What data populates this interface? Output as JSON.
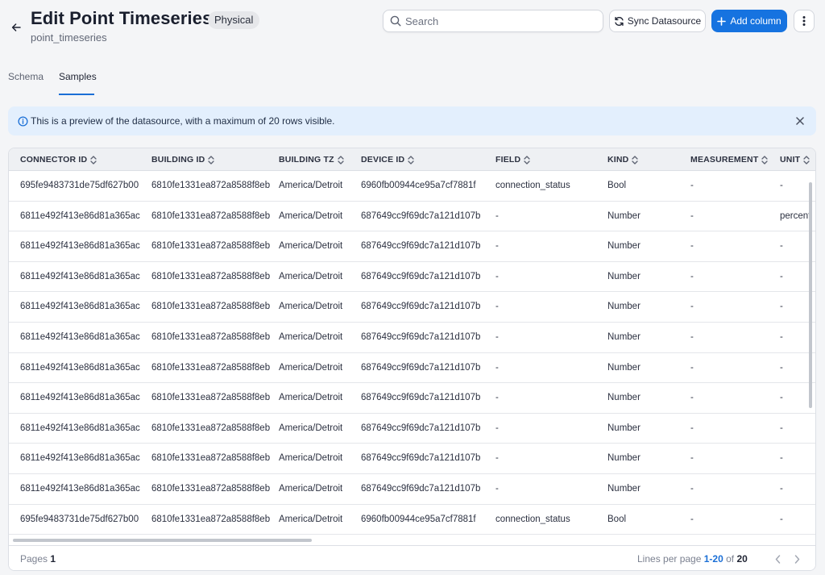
{
  "header": {
    "title": "Edit Point Timeseries",
    "badge": "Physical",
    "subtitle": "point_timeseries",
    "search_placeholder": "Search",
    "sync_label": "Sync Datasource",
    "add_label": "Add column"
  },
  "tabs": [
    {
      "label": "Schema",
      "active": false
    },
    {
      "label": "Samples",
      "active": true
    }
  ],
  "info": {
    "message": "This is a preview of the datasource, with a maximum of 20 rows visible."
  },
  "table": {
    "columns": [
      "CONNECTOR ID",
      "BUILDING ID",
      "BUILDING TZ",
      "DEVICE ID",
      "FIELD",
      "KIND",
      "MEASUREMENT",
      "UNIT"
    ],
    "rows": [
      [
        "695fe9483731de75df627b00",
        "6810fe1331ea872a8588f8eb",
        "America/Detroit",
        "6960fb00944ce95a7cf7881f",
        "connection_status",
        "Bool",
        "-",
        "-"
      ],
      [
        "6811e492f413e86d81a365ac",
        "6810fe1331ea872a8588f8eb",
        "America/Detroit",
        "687649cc9f69dc7a121d107b",
        "-",
        "Number",
        "-",
        "percent"
      ],
      [
        "6811e492f413e86d81a365ac",
        "6810fe1331ea872a8588f8eb",
        "America/Detroit",
        "687649cc9f69dc7a121d107b",
        "-",
        "Number",
        "-",
        "-"
      ],
      [
        "6811e492f413e86d81a365ac",
        "6810fe1331ea872a8588f8eb",
        "America/Detroit",
        "687649cc9f69dc7a121d107b",
        "-",
        "Number",
        "-",
        "-"
      ],
      [
        "6811e492f413e86d81a365ac",
        "6810fe1331ea872a8588f8eb",
        "America/Detroit",
        "687649cc9f69dc7a121d107b",
        "-",
        "Number",
        "-",
        "-"
      ],
      [
        "6811e492f413e86d81a365ac",
        "6810fe1331ea872a8588f8eb",
        "America/Detroit",
        "687649cc9f69dc7a121d107b",
        "-",
        "Number",
        "-",
        "-"
      ],
      [
        "6811e492f413e86d81a365ac",
        "6810fe1331ea872a8588f8eb",
        "America/Detroit",
        "687649cc9f69dc7a121d107b",
        "-",
        "Number",
        "-",
        "-"
      ],
      [
        "6811e492f413e86d81a365ac",
        "6810fe1331ea872a8588f8eb",
        "America/Detroit",
        "687649cc9f69dc7a121d107b",
        "-",
        "Number",
        "-",
        "-"
      ],
      [
        "6811e492f413e86d81a365ac",
        "6810fe1331ea872a8588f8eb",
        "America/Detroit",
        "687649cc9f69dc7a121d107b",
        "-",
        "Number",
        "-",
        "-"
      ],
      [
        "6811e492f413e86d81a365ac",
        "6810fe1331ea872a8588f8eb",
        "America/Detroit",
        "687649cc9f69dc7a121d107b",
        "-",
        "Number",
        "-",
        "-"
      ],
      [
        "6811e492f413e86d81a365ac",
        "6810fe1331ea872a8588f8eb",
        "America/Detroit",
        "687649cc9f69dc7a121d107b",
        "-",
        "Number",
        "-",
        "-"
      ],
      [
        "695fe9483731de75df627b00",
        "6810fe1331ea872a8588f8eb",
        "America/Detroit",
        "6960fb00944ce95a7cf7881f",
        "connection_status",
        "Bool",
        "-",
        "-"
      ]
    ]
  },
  "footer": {
    "pages_label": "Pages",
    "pages_value": "1",
    "lines_label": "Lines per page",
    "range": "1-20",
    "of_label": "of",
    "total": "20"
  },
  "colors": {
    "accent": "#1673e0",
    "info_bg": "#e3effd",
    "page_bg": "#f4f5f7"
  }
}
